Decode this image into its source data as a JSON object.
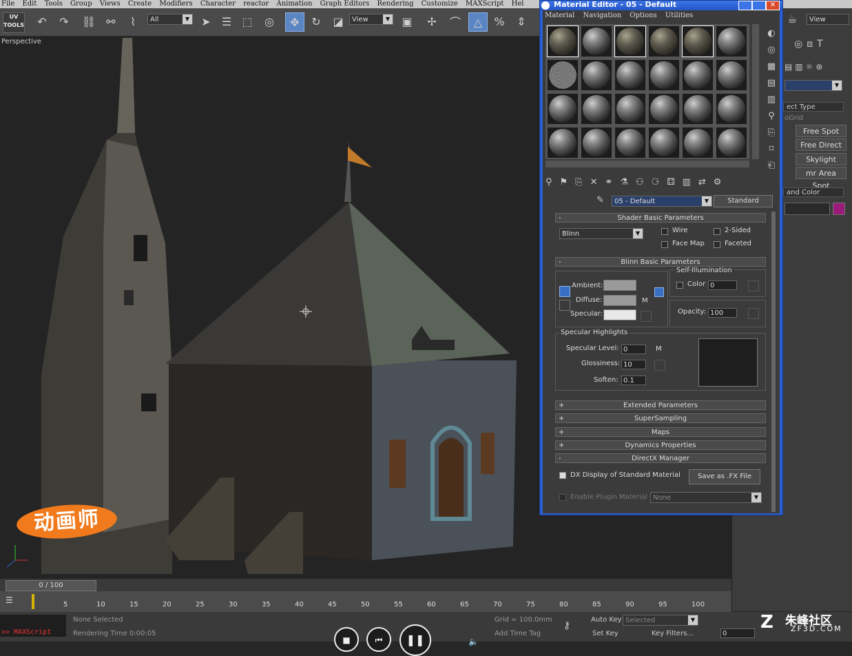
{
  "menubar": {
    "items": [
      "File",
      "Edit",
      "Tools",
      "Group",
      "Views",
      "Create",
      "Modifiers",
      "Character",
      "reactor",
      "Animation",
      "Graph Editors",
      "Rendering",
      "Customize",
      "MAXScript",
      "Hel"
    ]
  },
  "toolbar": {
    "uv_tools_label": "UV\nTOOLS",
    "selection_filter": "All",
    "ref_coord": "View"
  },
  "viewport": {
    "label": "Perspective"
  },
  "command_panel": {
    "view_dropdown": "View",
    "object_type_header": "ect Type",
    "autogrid": "oGrid",
    "buttons": [
      "Free Spot",
      "Free Direct",
      "Skylight",
      "mr Area Spot"
    ],
    "name_color_header": "and Color",
    "color_swatch": "#9b1a7a"
  },
  "material_editor": {
    "title": "Material Editor - 05 - Default",
    "menu": [
      "Material",
      "Navigation",
      "Options",
      "Utilities"
    ],
    "material_name": "05 - Default",
    "material_type": "Standard",
    "shader_rollout": "Shader Basic Parameters",
    "shader_type": "Blinn",
    "wire": "Wire",
    "two_sided": "2-Sided",
    "face_map": "Face Map",
    "faceted": "Faceted",
    "blinn_rollout": "Blinn Basic Parameters",
    "self_illum": "Self-Illumination",
    "color_label": "Color",
    "color_value": "0",
    "ambient": "Ambient:",
    "diffuse": "Diffuse:",
    "specular": "Specular:",
    "m_label": "M",
    "opacity_label": "Opacity:",
    "opacity_value": "100",
    "spec_highlights": "Specular Highlights",
    "spec_level_label": "Specular Level:",
    "spec_level": "0",
    "glossiness_label": "Glossiness:",
    "glossiness": "10",
    "soften_label": "Soften:",
    "soften": "0.1",
    "rollouts": [
      "Extended Parameters",
      "SuperSampling",
      "Maps",
      "Dynamics Properties",
      "DirectX Manager"
    ],
    "dx_display": "DX Display of Standard Material",
    "save_fx": "Save as .FX File",
    "enable_plugin": "Enable Plugin Material",
    "plugin_value": "None"
  },
  "timeline": {
    "frame": "0 / 100",
    "ticks": [
      "5",
      "10",
      "15",
      "20",
      "25",
      "30",
      "35",
      "40",
      "45",
      "50",
      "55",
      "60",
      "65",
      "70",
      "75",
      "80",
      "85",
      "90",
      "95",
      "100"
    ]
  },
  "status": {
    "none_selected": "None Selected",
    "rendering_time": "Rendering Time  0:00:05",
    "maxscript": ">> MAXScript",
    "grid": "Grid = 100.0mm",
    "add_time_tag": "Add Time Tag",
    "auto_key": "Auto Key",
    "selected": "Selected",
    "set_key": "Set Key",
    "key_filters": "Key Filters...",
    "frame_value": "0"
  },
  "watermarks": {
    "logo": "动画师",
    "site_cn": "朱峰社区",
    "site_url": "ZF3D.COM"
  }
}
